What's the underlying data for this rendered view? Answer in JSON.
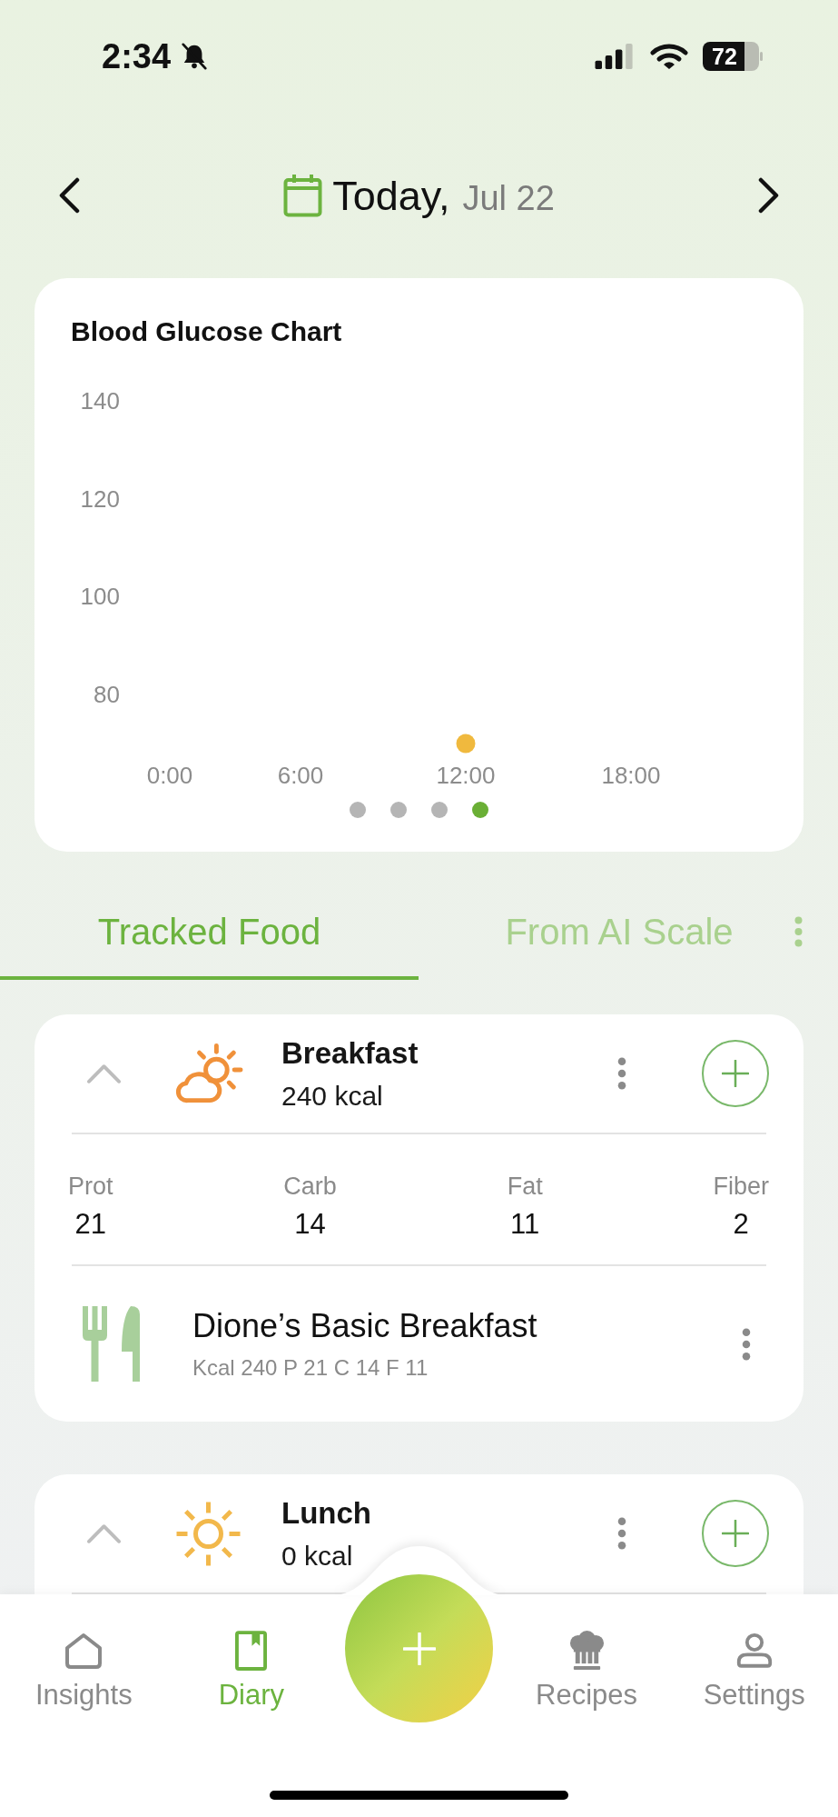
{
  "status_bar": {
    "time": "2:34",
    "battery": "72"
  },
  "header": {
    "title": "Today,",
    "date": "Jul 22"
  },
  "chart": {
    "title": "Blood Glucose Chart",
    "y_axis_labels": [
      "140",
      "120",
      "100",
      "80"
    ],
    "x_axis_labels": [
      "0:00",
      "6:00",
      "12:00",
      "18:00"
    ],
    "pager": [
      {
        "selected": false
      },
      {
        "selected": false
      },
      {
        "selected": false
      },
      {
        "selected": true
      }
    ]
  },
  "tabs": [
    {
      "label": "Tracked Food",
      "selected": true
    },
    {
      "label": "From AI Scale",
      "selected": false
    }
  ],
  "meals": [
    {
      "name": "Breakfast",
      "kcal": "240 kcal",
      "expanded": true,
      "macros": [
        {
          "label": "Prot",
          "value": "21"
        },
        {
          "label": "Carb",
          "value": "14"
        },
        {
          "label": "Fat",
          "value": "11"
        },
        {
          "label": "Fiber",
          "value": "2"
        }
      ],
      "foods": [
        {
          "name": "Dione’s Basic Breakfast",
          "details": "Kcal 240 P 21 C 14 F 11"
        }
      ]
    },
    {
      "name": "Lunch",
      "kcal": "0 kcal",
      "expanded": true
    }
  ],
  "bottom_nav": {
    "items": [
      {
        "label": "Insights",
        "selected": false
      },
      {
        "label": "Diary",
        "selected": true
      },
      {
        "label": "Recipes",
        "selected": false
      },
      {
        "label": "Settings",
        "selected": false
      }
    ]
  }
}
